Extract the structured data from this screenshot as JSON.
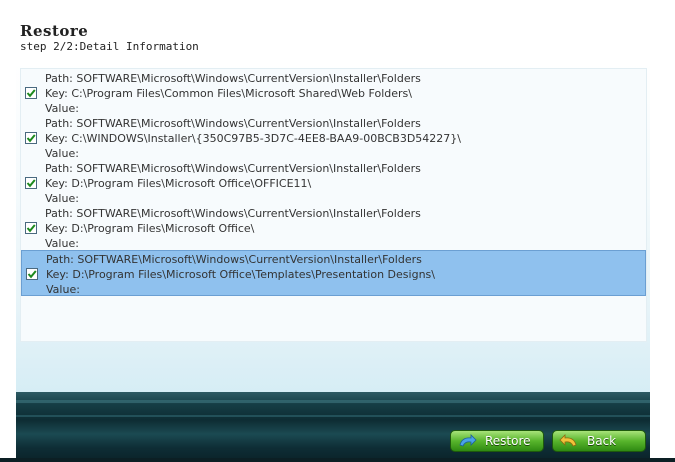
{
  "header": {
    "title": "Restore",
    "subtitle": "step 2/2:Detail Information"
  },
  "entries": [
    {
      "checked": true,
      "path": "Path: SOFTWARE\\Microsoft\\Windows\\CurrentVersion\\Installer\\Folders",
      "key": "Key: C:\\Program Files\\Common Files\\Microsoft Shared\\Web Folders\\",
      "value": "Value:"
    },
    {
      "checked": true,
      "path": "Path: SOFTWARE\\Microsoft\\Windows\\CurrentVersion\\Installer\\Folders",
      "key": "Key: C:\\WINDOWS\\Installer\\{350C97B5-3D7C-4EE8-BAA9-00BCB3D54227}\\",
      "value": "Value:"
    },
    {
      "checked": true,
      "path": "Path: SOFTWARE\\Microsoft\\Windows\\CurrentVersion\\Installer\\Folders",
      "key": "Key: D:\\Program Files\\Microsoft Office\\OFFICE11\\",
      "value": "Value:"
    },
    {
      "checked": true,
      "path": "Path: SOFTWARE\\Microsoft\\Windows\\CurrentVersion\\Installer\\Folders",
      "key": "Key: D:\\Program Files\\Microsoft Office\\",
      "value": "Value:"
    },
    {
      "checked": true,
      "selected": true,
      "path": "Path: SOFTWARE\\Microsoft\\Windows\\CurrentVersion\\Installer\\Folders",
      "key": "Key: D:\\Program Files\\Microsoft Office\\Templates\\Presentation Designs\\",
      "value": "Value:"
    }
  ],
  "buttons": {
    "restore_label": "Restore",
    "back_label": "Back",
    "restore_icon": "restore-arrow-icon",
    "back_icon": "back-arrow-icon"
  },
  "colors": {
    "selection": "#8fc1ee",
    "button_green": "#58b52c",
    "footer_dark": "#0d2c33"
  }
}
